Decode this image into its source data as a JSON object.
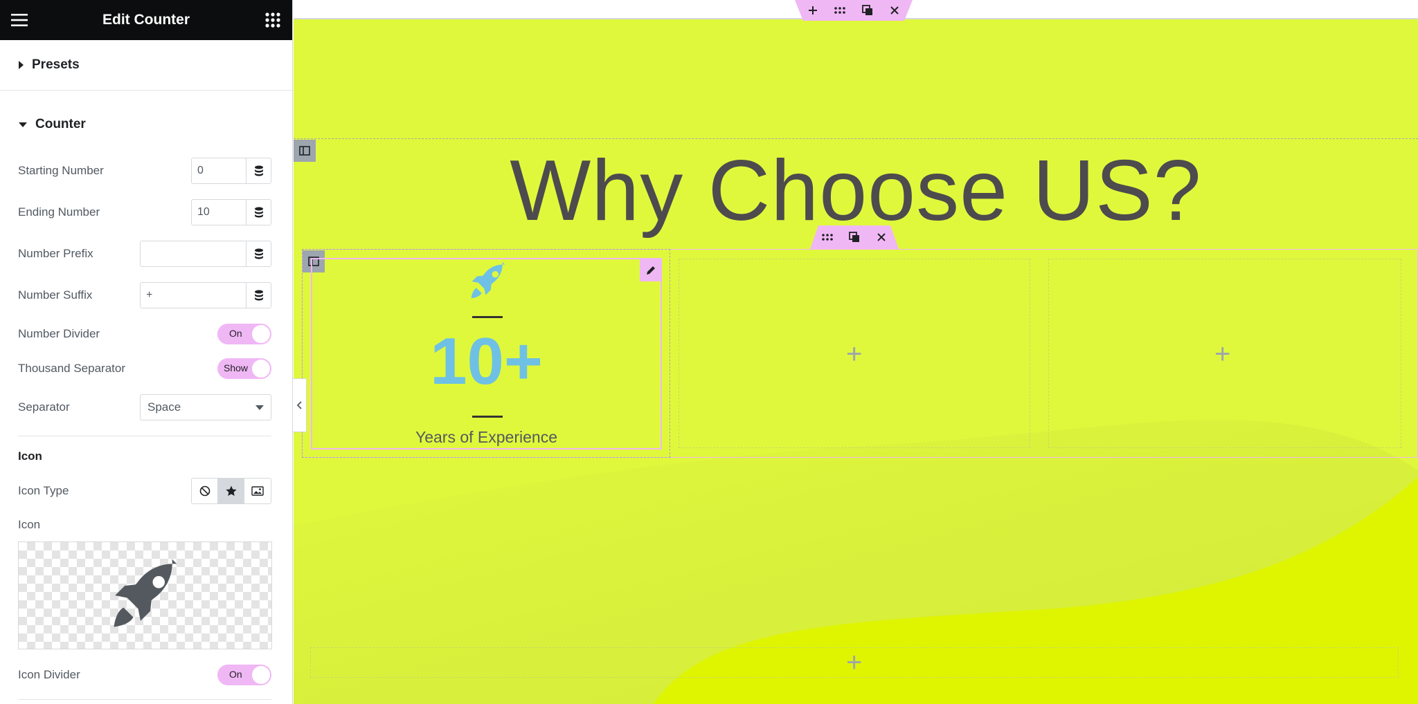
{
  "panel": {
    "title": "Edit Counter",
    "sections": {
      "presets": "Presets",
      "counter": "Counter",
      "icon_heading": "Icon"
    },
    "controls": {
      "starting_number": {
        "label": "Starting Number",
        "value": "0"
      },
      "ending_number": {
        "label": "Ending Number",
        "value": "10"
      },
      "number_prefix": {
        "label": "Number Prefix",
        "value": ""
      },
      "number_suffix": {
        "label": "Number Suffix",
        "value": "+"
      },
      "number_divider": {
        "label": "Number Divider",
        "toggle": "On"
      },
      "thousand_separator": {
        "label": "Thousand Separator",
        "toggle": "Show"
      },
      "separator": {
        "label": "Separator",
        "value": "Space"
      },
      "icon_type": {
        "label": "Icon Type",
        "options": [
          "none-icon",
          "star-icon",
          "image-icon"
        ],
        "selected": "star-icon"
      },
      "icon": {
        "label": "Icon",
        "selected_icon": "rocket-icon"
      },
      "icon_divider": {
        "label": "Icon Divider",
        "toggle": "On"
      }
    }
  },
  "canvas": {
    "background": "#e0f83c",
    "heading": "Why Choose US?",
    "counter_widget": {
      "icon": "rocket-icon",
      "number": "10+",
      "title": "Years of Experience",
      "number_color": "#6ec1e4"
    },
    "accent": "#f0b7f5"
  }
}
